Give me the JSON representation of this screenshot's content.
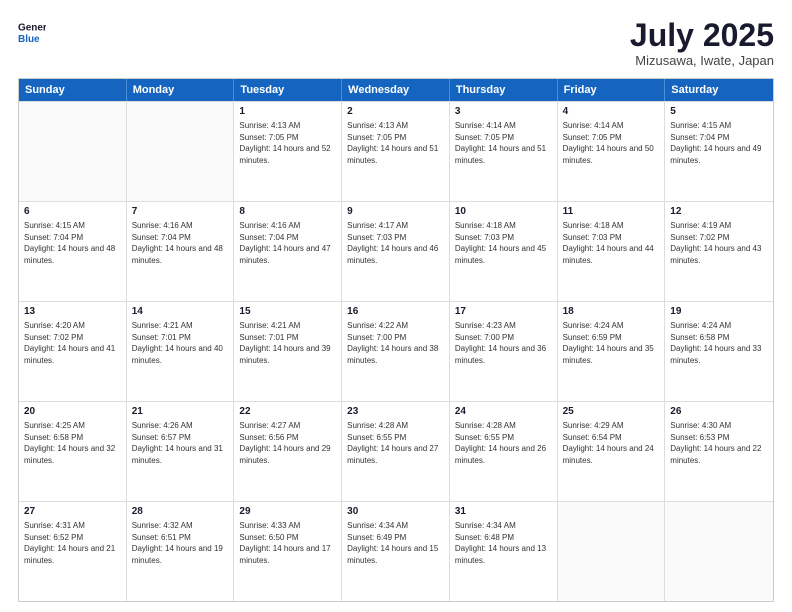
{
  "logo": {
    "general": "General",
    "blue": "Blue"
  },
  "header": {
    "month": "July 2025",
    "location": "Mizusawa, Iwate, Japan"
  },
  "days": [
    "Sunday",
    "Monday",
    "Tuesday",
    "Wednesday",
    "Thursday",
    "Friday",
    "Saturday"
  ],
  "weeks": [
    [
      {
        "day": "",
        "sunrise": "",
        "sunset": "",
        "daylight": ""
      },
      {
        "day": "",
        "sunrise": "",
        "sunset": "",
        "daylight": ""
      },
      {
        "day": "1",
        "sunrise": "Sunrise: 4:13 AM",
        "sunset": "Sunset: 7:05 PM",
        "daylight": "Daylight: 14 hours and 52 minutes."
      },
      {
        "day": "2",
        "sunrise": "Sunrise: 4:13 AM",
        "sunset": "Sunset: 7:05 PM",
        "daylight": "Daylight: 14 hours and 51 minutes."
      },
      {
        "day": "3",
        "sunrise": "Sunrise: 4:14 AM",
        "sunset": "Sunset: 7:05 PM",
        "daylight": "Daylight: 14 hours and 51 minutes."
      },
      {
        "day": "4",
        "sunrise": "Sunrise: 4:14 AM",
        "sunset": "Sunset: 7:05 PM",
        "daylight": "Daylight: 14 hours and 50 minutes."
      },
      {
        "day": "5",
        "sunrise": "Sunrise: 4:15 AM",
        "sunset": "Sunset: 7:04 PM",
        "daylight": "Daylight: 14 hours and 49 minutes."
      }
    ],
    [
      {
        "day": "6",
        "sunrise": "Sunrise: 4:15 AM",
        "sunset": "Sunset: 7:04 PM",
        "daylight": "Daylight: 14 hours and 48 minutes."
      },
      {
        "day": "7",
        "sunrise": "Sunrise: 4:16 AM",
        "sunset": "Sunset: 7:04 PM",
        "daylight": "Daylight: 14 hours and 48 minutes."
      },
      {
        "day": "8",
        "sunrise": "Sunrise: 4:16 AM",
        "sunset": "Sunset: 7:04 PM",
        "daylight": "Daylight: 14 hours and 47 minutes."
      },
      {
        "day": "9",
        "sunrise": "Sunrise: 4:17 AM",
        "sunset": "Sunset: 7:03 PM",
        "daylight": "Daylight: 14 hours and 46 minutes."
      },
      {
        "day": "10",
        "sunrise": "Sunrise: 4:18 AM",
        "sunset": "Sunset: 7:03 PM",
        "daylight": "Daylight: 14 hours and 45 minutes."
      },
      {
        "day": "11",
        "sunrise": "Sunrise: 4:18 AM",
        "sunset": "Sunset: 7:03 PM",
        "daylight": "Daylight: 14 hours and 44 minutes."
      },
      {
        "day": "12",
        "sunrise": "Sunrise: 4:19 AM",
        "sunset": "Sunset: 7:02 PM",
        "daylight": "Daylight: 14 hours and 43 minutes."
      }
    ],
    [
      {
        "day": "13",
        "sunrise": "Sunrise: 4:20 AM",
        "sunset": "Sunset: 7:02 PM",
        "daylight": "Daylight: 14 hours and 41 minutes."
      },
      {
        "day": "14",
        "sunrise": "Sunrise: 4:21 AM",
        "sunset": "Sunset: 7:01 PM",
        "daylight": "Daylight: 14 hours and 40 minutes."
      },
      {
        "day": "15",
        "sunrise": "Sunrise: 4:21 AM",
        "sunset": "Sunset: 7:01 PM",
        "daylight": "Daylight: 14 hours and 39 minutes."
      },
      {
        "day": "16",
        "sunrise": "Sunrise: 4:22 AM",
        "sunset": "Sunset: 7:00 PM",
        "daylight": "Daylight: 14 hours and 38 minutes."
      },
      {
        "day": "17",
        "sunrise": "Sunrise: 4:23 AM",
        "sunset": "Sunset: 7:00 PM",
        "daylight": "Daylight: 14 hours and 36 minutes."
      },
      {
        "day": "18",
        "sunrise": "Sunrise: 4:24 AM",
        "sunset": "Sunset: 6:59 PM",
        "daylight": "Daylight: 14 hours and 35 minutes."
      },
      {
        "day": "19",
        "sunrise": "Sunrise: 4:24 AM",
        "sunset": "Sunset: 6:58 PM",
        "daylight": "Daylight: 14 hours and 33 minutes."
      }
    ],
    [
      {
        "day": "20",
        "sunrise": "Sunrise: 4:25 AM",
        "sunset": "Sunset: 6:58 PM",
        "daylight": "Daylight: 14 hours and 32 minutes."
      },
      {
        "day": "21",
        "sunrise": "Sunrise: 4:26 AM",
        "sunset": "Sunset: 6:57 PM",
        "daylight": "Daylight: 14 hours and 31 minutes."
      },
      {
        "day": "22",
        "sunrise": "Sunrise: 4:27 AM",
        "sunset": "Sunset: 6:56 PM",
        "daylight": "Daylight: 14 hours and 29 minutes."
      },
      {
        "day": "23",
        "sunrise": "Sunrise: 4:28 AM",
        "sunset": "Sunset: 6:55 PM",
        "daylight": "Daylight: 14 hours and 27 minutes."
      },
      {
        "day": "24",
        "sunrise": "Sunrise: 4:28 AM",
        "sunset": "Sunset: 6:55 PM",
        "daylight": "Daylight: 14 hours and 26 minutes."
      },
      {
        "day": "25",
        "sunrise": "Sunrise: 4:29 AM",
        "sunset": "Sunset: 6:54 PM",
        "daylight": "Daylight: 14 hours and 24 minutes."
      },
      {
        "day": "26",
        "sunrise": "Sunrise: 4:30 AM",
        "sunset": "Sunset: 6:53 PM",
        "daylight": "Daylight: 14 hours and 22 minutes."
      }
    ],
    [
      {
        "day": "27",
        "sunrise": "Sunrise: 4:31 AM",
        "sunset": "Sunset: 6:52 PM",
        "daylight": "Daylight: 14 hours and 21 minutes."
      },
      {
        "day": "28",
        "sunrise": "Sunrise: 4:32 AM",
        "sunset": "Sunset: 6:51 PM",
        "daylight": "Daylight: 14 hours and 19 minutes."
      },
      {
        "day": "29",
        "sunrise": "Sunrise: 4:33 AM",
        "sunset": "Sunset: 6:50 PM",
        "daylight": "Daylight: 14 hours and 17 minutes."
      },
      {
        "day": "30",
        "sunrise": "Sunrise: 4:34 AM",
        "sunset": "Sunset: 6:49 PM",
        "daylight": "Daylight: 14 hours and 15 minutes."
      },
      {
        "day": "31",
        "sunrise": "Sunrise: 4:34 AM",
        "sunset": "Sunset: 6:48 PM",
        "daylight": "Daylight: 14 hours and 13 minutes."
      },
      {
        "day": "",
        "sunrise": "",
        "sunset": "",
        "daylight": ""
      },
      {
        "day": "",
        "sunrise": "",
        "sunset": "",
        "daylight": ""
      }
    ]
  ]
}
